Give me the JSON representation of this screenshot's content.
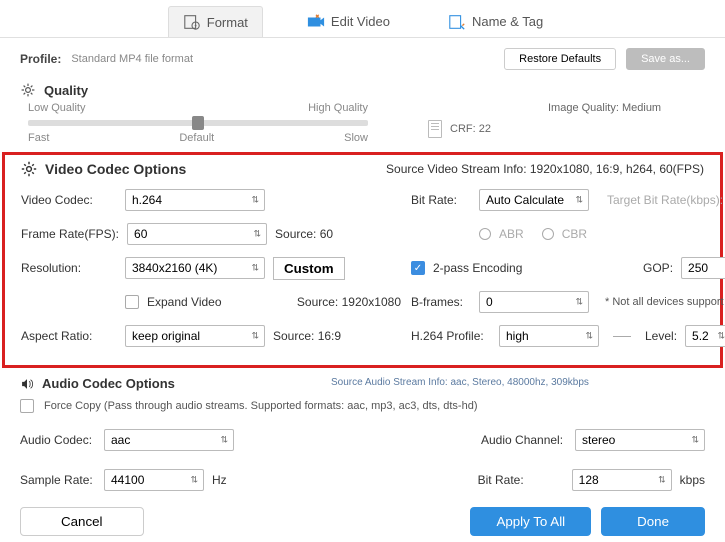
{
  "tabs": {
    "format": "Format",
    "edit": "Edit Video",
    "name": "Name & Tag"
  },
  "profile": {
    "label": "Profile:",
    "value": "Standard MP4 file format",
    "restore": "Restore Defaults",
    "saveas": "Save as..."
  },
  "quality": {
    "title": "Quality",
    "low": "Low Quality",
    "high": "High Quality",
    "fast": "Fast",
    "default": "Default",
    "slow": "Slow",
    "imgq": "Image Quality: Medium",
    "crf": "CRF: 22"
  },
  "video": {
    "title": "Video Codec Options",
    "source_info": "Source Video Stream Info: 1920x1080, 16:9, h264, 60(FPS)",
    "codec_lbl": "Video Codec:",
    "codec": "h.264",
    "fps_lbl": "Frame Rate(FPS):",
    "fps": "60",
    "fps_src": "Source: 60",
    "res_lbl": "Resolution:",
    "res": "3840x2160 (4K)",
    "custom": "Custom",
    "expand": "Expand Video",
    "res_src": "Source: 1920x1080",
    "ar_lbl": "Aspect Ratio:",
    "ar": "keep original",
    "ar_src": "Source: 16:9",
    "br_lbl": "Bit Rate:",
    "br": "Auto Calculate",
    "tbr": "Target Bit Rate(kbps):",
    "abr": "ABR",
    "cbr": "CBR",
    "twopass": "2-pass Encoding",
    "gop_lbl": "GOP:",
    "gop": "250",
    "bframes_lbl": "B-frames:",
    "bframes": "0",
    "note": "* Not all devices support l",
    "profile_lbl": "H.264 Profile:",
    "profile": "high",
    "level_lbl": "Level:",
    "level": "5.2"
  },
  "audio": {
    "title": "Audio Codec Options",
    "src": "Source Audio Stream Info: aac, Stereo, 48000hz, 309kbps",
    "force": "Force Copy (Pass through audio streams. Supported formats: aac, mp3, ac3, dts, dts-hd)",
    "codec_lbl": "Audio Codec:",
    "codec": "aac",
    "ch_lbl": "Audio Channel:",
    "ch": "stereo",
    "sr_lbl": "Sample Rate:",
    "sr": "44100",
    "hz": "Hz",
    "br_lbl": "Bit Rate:",
    "br": "128",
    "kbps": "kbps"
  },
  "footer": {
    "cancel": "Cancel",
    "apply": "Apply To All",
    "done": "Done"
  }
}
